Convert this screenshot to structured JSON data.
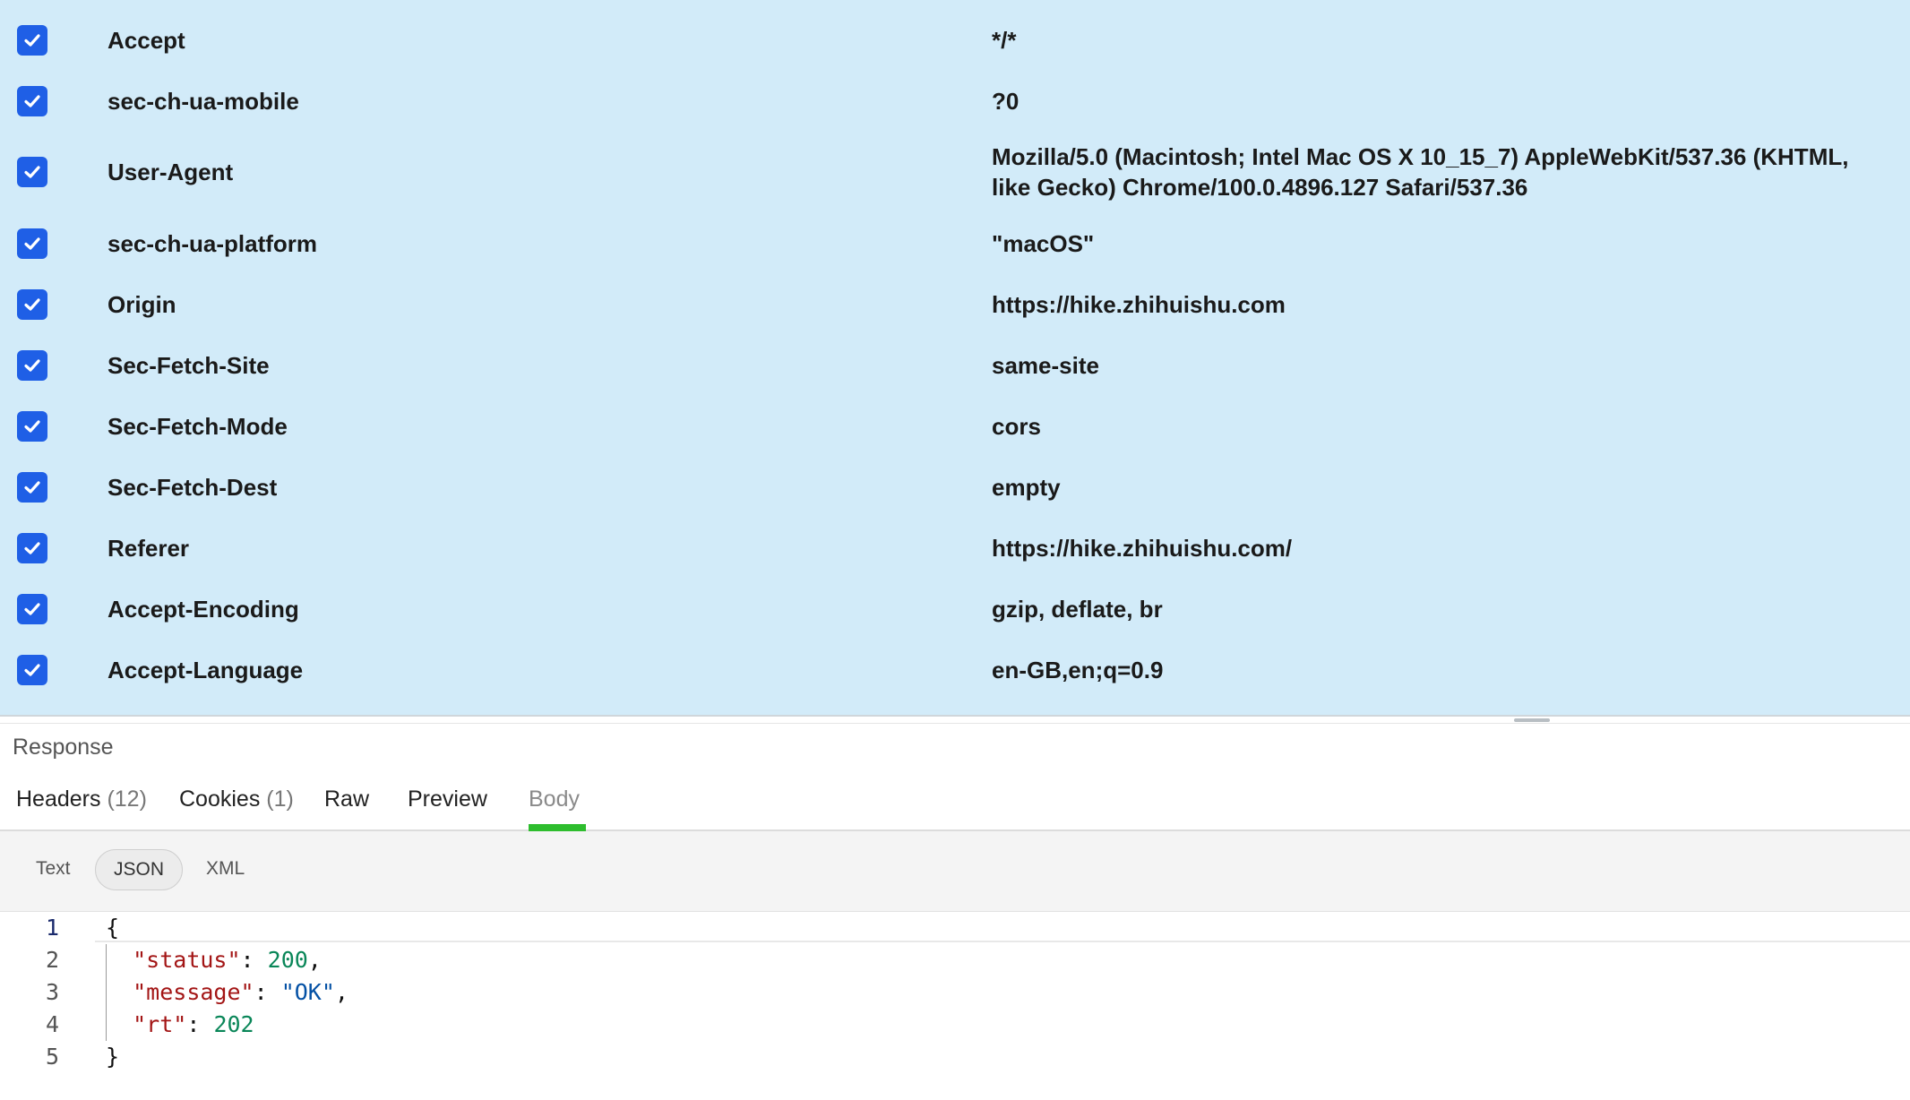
{
  "request_headers": [
    {
      "key": "Accept",
      "value": "*/*",
      "enabled": true
    },
    {
      "key": "sec-ch-ua-mobile",
      "value": "?0",
      "enabled": true
    },
    {
      "key": "User-Agent",
      "value": "Mozilla/5.0 (Macintosh; Intel Mac OS X 10_15_7) AppleWebKit/537.36 (KHTML, like Gecko) Chrome/100.0.4896.127 Safari/537.36",
      "enabled": true
    },
    {
      "key": "sec-ch-ua-platform",
      "value": "\"macOS\"",
      "enabled": true
    },
    {
      "key": "Origin",
      "value": "https://hike.zhihuishu.com",
      "enabled": true
    },
    {
      "key": "Sec-Fetch-Site",
      "value": "same-site",
      "enabled": true
    },
    {
      "key": "Sec-Fetch-Mode",
      "value": "cors",
      "enabled": true
    },
    {
      "key": "Sec-Fetch-Dest",
      "value": "empty",
      "enabled": true
    },
    {
      "key": "Referer",
      "value": "https://hike.zhihuishu.com/",
      "enabled": true
    },
    {
      "key": "Accept-Encoding",
      "value": "gzip, deflate, br",
      "enabled": true
    },
    {
      "key": "Accept-Language",
      "value": "en-GB,en;q=0.9",
      "enabled": true
    }
  ],
  "response": {
    "title": "Response",
    "tabs": [
      {
        "label": "Headers",
        "count": "(12)"
      },
      {
        "label": "Cookies",
        "count": "(1)"
      },
      {
        "label": "Raw",
        "count": ""
      },
      {
        "label": "Preview",
        "count": ""
      },
      {
        "label": "Body",
        "count": ""
      }
    ],
    "active_tab": "Body",
    "formats": [
      "Text",
      "JSON",
      "XML"
    ],
    "active_format": "JSON",
    "body_lines": [
      {
        "no": "1",
        "text": "{"
      },
      {
        "no": "2",
        "key": "\"status\"",
        "value": "200",
        "type": "number",
        "trail": ","
      },
      {
        "no": "3",
        "key": "\"message\"",
        "value": "\"OK\"",
        "type": "string",
        "trail": ","
      },
      {
        "no": "4",
        "key": "\"rt\"",
        "value": "202",
        "type": "number",
        "trail": ""
      },
      {
        "no": "5",
        "text": "}"
      }
    ]
  },
  "colors": {
    "headers_background": "#d2ebf9",
    "checkbox": "#1f5fe6",
    "active_tab_underline": "#2ebd2e",
    "json_key": "#a31515",
    "json_number": "#098658",
    "json_string": "#0451a5"
  }
}
